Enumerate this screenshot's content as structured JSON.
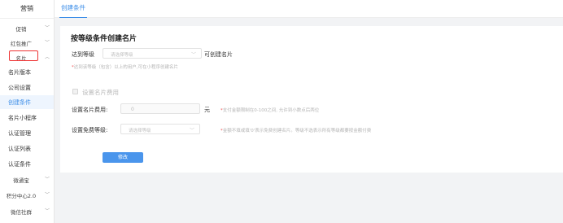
{
  "sidebar": {
    "title": "营销",
    "groups": [
      {
        "label": "促销",
        "chevron": "﹀"
      },
      {
        "label": "红包推广",
        "chevron": "﹀"
      },
      {
        "label": "名片",
        "chevron": "︿"
      }
    ],
    "sub_items": [
      {
        "label": "名片版本"
      },
      {
        "label": "公司设置"
      },
      {
        "label": "创建条件"
      },
      {
        "label": "名片小程序"
      },
      {
        "label": "认证管理"
      },
      {
        "label": "认证列表"
      },
      {
        "label": "认证条件"
      }
    ],
    "bottom_groups": [
      {
        "label": "微通宝",
        "chevron": "﹀"
      },
      {
        "label": "积分中心2.0",
        "chevron": "﹀"
      },
      {
        "label": "微信社群",
        "chevron": "﹀"
      }
    ]
  },
  "topbar": {
    "active_tab": "创建条件"
  },
  "form": {
    "title": "按等级条件创建名片",
    "level_label": "达到等级",
    "level_placeholder": "请选择等级",
    "level_suffix": "可创建名片",
    "level_hint_star": "*",
    "level_hint": "达到该等级（包含）以上的用户,可在小程序创建名片",
    "fee_checkbox_label": "设置名片费用",
    "fee_label": "设置名片费用:",
    "fee_value": "0",
    "fee_unit": "元",
    "fee_hint_star": "*",
    "fee_hint": "支付金额限制在0-100之间, 允许到小数点后两位",
    "free_label": "设置免费等级:",
    "free_placeholder": "请选择等级",
    "free_hint_star": "*",
    "free_hint": "金额不填或填'0'表示免费创建名片。等级不选表示所有等级都要按金额付费",
    "submit_label": "修改"
  }
}
